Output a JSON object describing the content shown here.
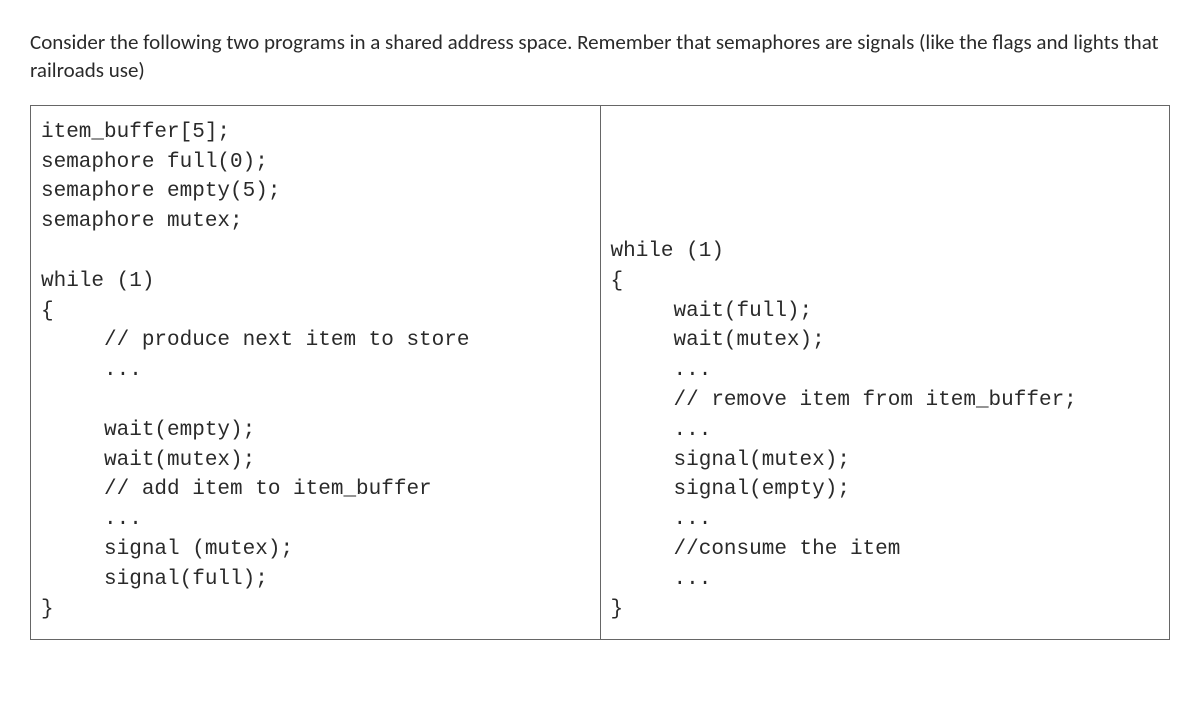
{
  "prompt": "Consider the following two programs in a shared address space.  Remember that semaphores are signals (like the flags and lights that railroads use)",
  "code": {
    "left": "item_buffer[5];\nsemaphore full(0);\nsemaphore empty(5);\nsemaphore mutex;\n\nwhile (1)\n{\n     // produce next item to store\n     ...\n\n     wait(empty);\n     wait(mutex);\n     // add item to item_buffer\n     ...\n     signal (mutex);\n     signal(full);\n}",
    "right": "\n\n\n\nwhile (1)\n{\n     wait(full);\n     wait(mutex);\n     ...\n     // remove item from item_buffer;\n     ...\n     signal(mutex);\n     signal(empty);\n     ...\n     //consume the item\n     ...\n}"
  }
}
